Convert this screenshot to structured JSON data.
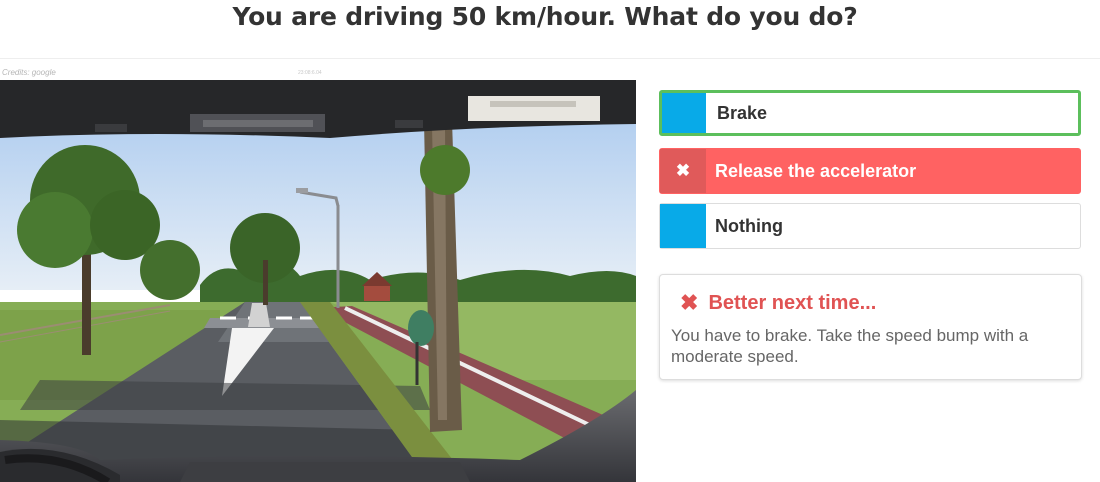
{
  "question": "You are driving 50 km/hour. What do you do?",
  "image": {
    "credits": "Credits: google",
    "code": "23:08:6.04"
  },
  "answers": [
    {
      "label": "Brake",
      "state": "correct",
      "marker_icon": ""
    },
    {
      "label": "Release the accelerator",
      "state": "wrong-selected",
      "marker_icon": "✖"
    },
    {
      "label": "Nothing",
      "state": "neutral",
      "marker_icon": ""
    }
  ],
  "feedback": {
    "icon": "✖",
    "title": "Better next time...",
    "text": "You have to brake. Take the speed bump with a moderate speed."
  },
  "colors": {
    "marker_blue": "#08aae8",
    "correct_border": "#5cbf5c",
    "wrong_bg": "#ff6262",
    "feedback_title": "#e05353"
  }
}
